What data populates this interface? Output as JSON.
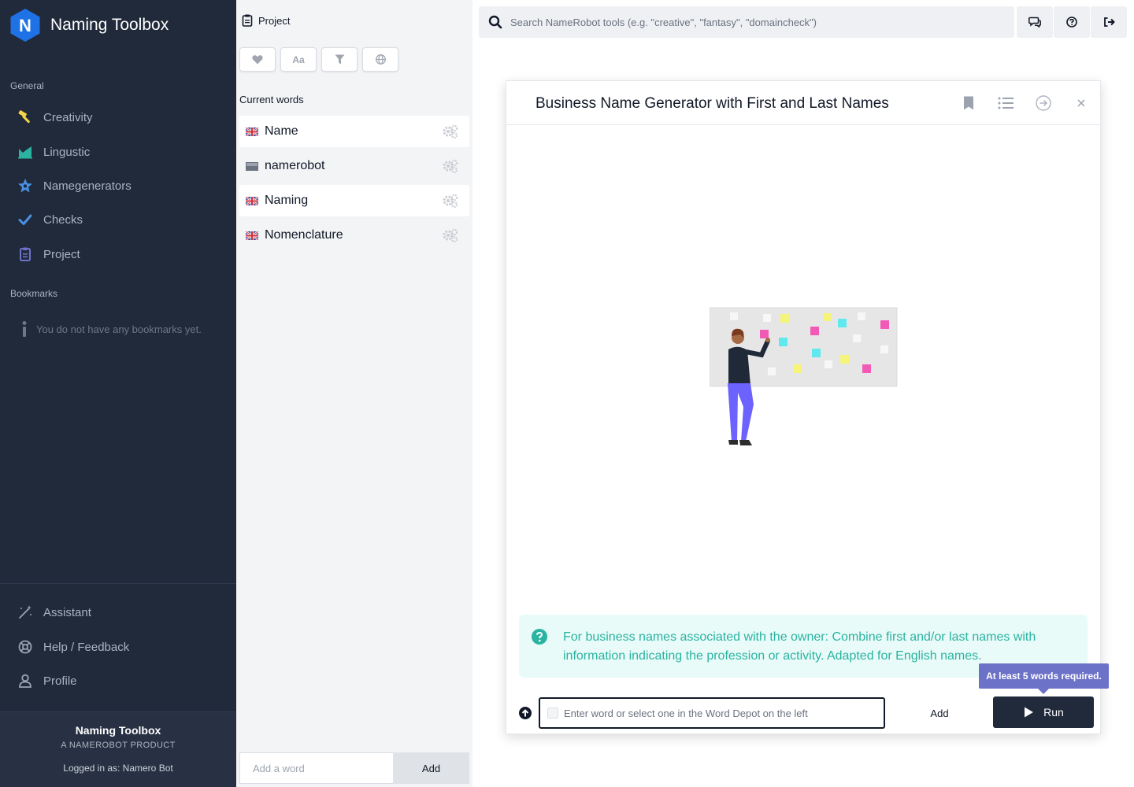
{
  "app": {
    "name": "Naming Toolbox",
    "logo_letter": "N",
    "colors": {
      "sidebar": "#212a3b",
      "brand": "#1e72e6",
      "accent_teal": "#2ab3a1",
      "tooltip": "#6d72c9"
    }
  },
  "sidebar": {
    "general_label": "General",
    "nav": [
      {
        "label": "Creativity",
        "icon": "hammer-icon"
      },
      {
        "label": "Lingustic",
        "icon": "area-chart-icon"
      },
      {
        "label": "Namegenerators",
        "icon": "star-badge-icon"
      },
      {
        "label": "Checks",
        "icon": "check-icon"
      },
      {
        "label": "Project",
        "icon": "clipboard-icon"
      }
    ],
    "bookmarks_label": "Bookmarks",
    "bookmarks_empty": "You do not have any bookmarks yet.",
    "bottom_nav": [
      {
        "label": "Assistant",
        "icon": "magic-wand-icon"
      },
      {
        "label": "Help / Feedback",
        "icon": "lifebuoy-icon"
      },
      {
        "label": "Profile",
        "icon": "user-icon"
      }
    ],
    "footer": {
      "title": "Naming Toolbox",
      "subtitle": "A NAMEROBOT PRODUCT",
      "logged_in": "Logged in as: Namero Bot"
    }
  },
  "project_panel": {
    "title": "Project",
    "filters": [
      {
        "icon": "heart-icon"
      },
      {
        "icon": "font-case-icon",
        "text": "Aa"
      },
      {
        "icon": "filter-icon"
      },
      {
        "icon": "globe-icon"
      }
    ],
    "current_words_label": "Current words",
    "words": [
      {
        "word": "Name",
        "flag": "uk-flag-icon",
        "active": true
      },
      {
        "word": "namerobot",
        "flag": "neutral-flag-icon",
        "active": false
      },
      {
        "word": "Naming",
        "flag": "uk-flag-icon",
        "active": true
      },
      {
        "word": "Nomenclature",
        "flag": "uk-flag-icon",
        "active": false
      }
    ],
    "add_word": {
      "placeholder": "Add a word",
      "button": "Add"
    }
  },
  "search": {
    "placeholder": "Search NameRobot tools (e.g. \"creative\", \"fantasy\", \"domaincheck\")"
  },
  "top_actions": [
    {
      "icon": "chat-icon"
    },
    {
      "icon": "question-circle-icon"
    },
    {
      "icon": "logout-icon"
    }
  ],
  "modal": {
    "title": "Business Name Generator with First and Last Names",
    "info_text": "For business names associated with the owner: Combine first and/or last names with information indicating the profession or activity. Adapted for English names.",
    "input_placeholder": "Enter word or select one in the Word Depot on the left",
    "add_label": "Add",
    "run_label": "Run",
    "tooltip": "At least 5 words required."
  }
}
